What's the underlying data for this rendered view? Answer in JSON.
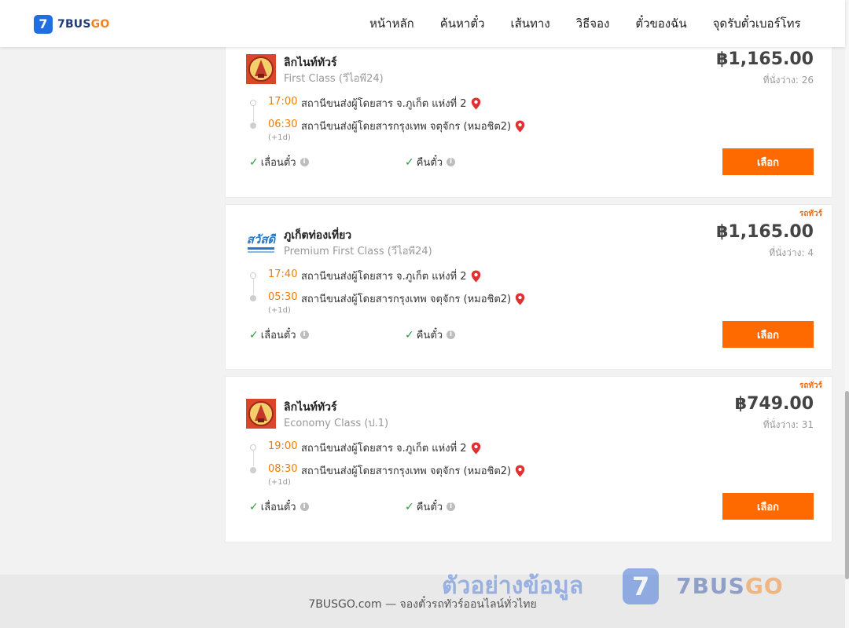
{
  "brand": {
    "logo_mark": "7",
    "name_main": "7BUS",
    "name_accent": "GO"
  },
  "nav": [
    {
      "label": "หน้าหลัก"
    },
    {
      "label": "ค้นหาตั๋ว"
    },
    {
      "label": "เส้นทาง"
    },
    {
      "label": "วิธีจอง"
    },
    {
      "label": "ตั๋วของฉัน"
    },
    {
      "label": "จุดรับตั๋วเบอร์โทร"
    }
  ],
  "trips": [
    {
      "tag": "",
      "operator": "ลิกไนท์ทัวร์",
      "class": "First Class (วีไอพี24)",
      "price": "฿1,165.00",
      "seats": "ที่นั่งว่าง: 26",
      "depart_time": "17:00",
      "depart_station": "สถานีขนส่งผู้โดยสาร จ.ภูเก็ต แห่งที่ 2",
      "arrive_time": "06:30",
      "arrive_station": "สถานีขนส่งผู้โดยสารกรุงเทพ จตุจักร (หมอชิต2)",
      "plus_day": "(+1d)",
      "feature1": "เลื่อนตั๋ว",
      "feature2": "คืนตั๋ว",
      "button": "เลือก"
    },
    {
      "tag": "รถทัวร์",
      "operator": "ภูเก็ตท่องเที่ยว",
      "class": "Premium First Class (วีไอพี24)",
      "price": "฿1,165.00",
      "seats": "ที่นั่งว่าง: 4",
      "depart_time": "17:40",
      "depart_station": "สถานีขนส่งผู้โดยสาร จ.ภูเก็ต แห่งที่ 2",
      "arrive_time": "05:30",
      "arrive_station": "สถานีขนส่งผู้โดยสารกรุงเทพ จตุจักร (หมอชิต2)",
      "plus_day": "(+1d)",
      "feature1": "เลื่อนตั๋ว",
      "feature2": "คืนตั๋ว",
      "button": "เลือก"
    },
    {
      "tag": "รถทัวร์",
      "operator": "ลิกไนท์ทัวร์",
      "class": "Economy Class (ป.1)",
      "price": "฿749.00",
      "seats": "ที่นั่งว่าง: 31",
      "depart_time": "19:00",
      "depart_station": "สถานีขนส่งผู้โดยสาร จ.ภูเก็ต แห่งที่ 2",
      "arrive_time": "08:30",
      "arrive_station": "สถานีขนส่งผู้โดยสารกรุงเทพ จตุจักร (หมอชิต2)",
      "plus_day": "(+1d)",
      "feature1": "เลื่อนตั๋ว",
      "feature2": "คืนตั๋ว",
      "button": "เลือก"
    }
  ],
  "operator_logo_text": "สวัสดี",
  "footer": {
    "text": "7BUSGO.com — จองตั๋วรถทัวร์ออนไลน์ทั่วไทย"
  },
  "watermark": {
    "text": "ตัวอย่างข้อมูล",
    "logo_mark": "7",
    "brand_main": "7BUS",
    "brand_accent": "GO"
  },
  "colors": {
    "accent": "#ff6a00",
    "time": "#f07d00",
    "brand_blue": "#1f6fe0",
    "check": "#2a9a3c",
    "pin": "#e03030"
  },
  "icons": [
    "location-pin-icon",
    "check-icon",
    "info-icon"
  ]
}
